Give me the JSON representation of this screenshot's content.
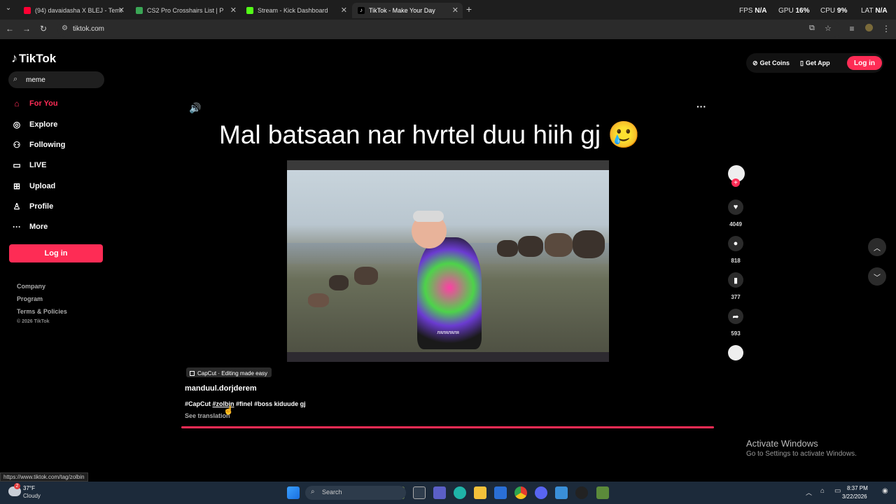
{
  "browser": {
    "tabs": [
      {
        "title": "(94) davaidasha X BLEJ - Temtm",
        "color": "#ff0033"
      },
      {
        "title": "CS2 Pro Crosshairs List | ProCr",
        "color": "#3aa655"
      },
      {
        "title": "Stream - Kick Dashboard",
        "color": "#53fc18"
      },
      {
        "title": "TikTok - Make Your Day",
        "color": "#ffffff"
      }
    ],
    "new_tab": "+",
    "url": "tiktok.com",
    "hud": {
      "fps_label": "FPS",
      "fps_val": "N/A",
      "gpu_label": "GPU",
      "gpu_val": "16%",
      "cpu_label": "CPU",
      "cpu_val": "9%",
      "lat_label": "LAT",
      "lat_val": "N/A"
    }
  },
  "sidebar": {
    "logo": "TikTok",
    "search_value": "meme",
    "items": [
      {
        "label": "For You",
        "icon": "home-icon",
        "active": true
      },
      {
        "label": "Explore",
        "icon": "compass-icon"
      },
      {
        "label": "Following",
        "icon": "following-icon"
      },
      {
        "label": "LIVE",
        "icon": "live-icon"
      },
      {
        "label": "Upload",
        "icon": "upload-icon"
      },
      {
        "label": "Profile",
        "icon": "profile-icon"
      },
      {
        "label": "More",
        "icon": "more-icon"
      }
    ],
    "login": "Log in",
    "footer": [
      "Company",
      "Program",
      "Terms & Policies"
    ],
    "copyright": "© 2026 TikTok"
  },
  "topbar": {
    "get_coins": "Get Coins",
    "get_app": "Get App",
    "login": "Log in"
  },
  "video": {
    "caption": "Mal batsaan nar hvrtel duu hiih gj",
    "caption_emoji": "🥲",
    "subtitle": "ляляляля",
    "capcut": "CapCut · Editing made easy",
    "author": "manduul.dorjderem",
    "hashtags": [
      "#CapCut",
      "#zolbin",
      "#finel",
      "#boss",
      "kiduude gj"
    ],
    "see_translation": "See translation",
    "counts": {
      "likes": "4049",
      "comments": "818",
      "saves": "377",
      "shares": "593"
    }
  },
  "overlay": {
    "activate_title": "Activate Windows",
    "activate_sub": "Go to Settings to activate Windows.",
    "status_url": "https://www.tiktok.com/tag/zolbin"
  },
  "taskbar": {
    "temp": "37°F",
    "weather": "Cloudy",
    "weather_badge": "2",
    "search": "Search",
    "time": "8:37 PM",
    "date": "3/22/2026"
  }
}
